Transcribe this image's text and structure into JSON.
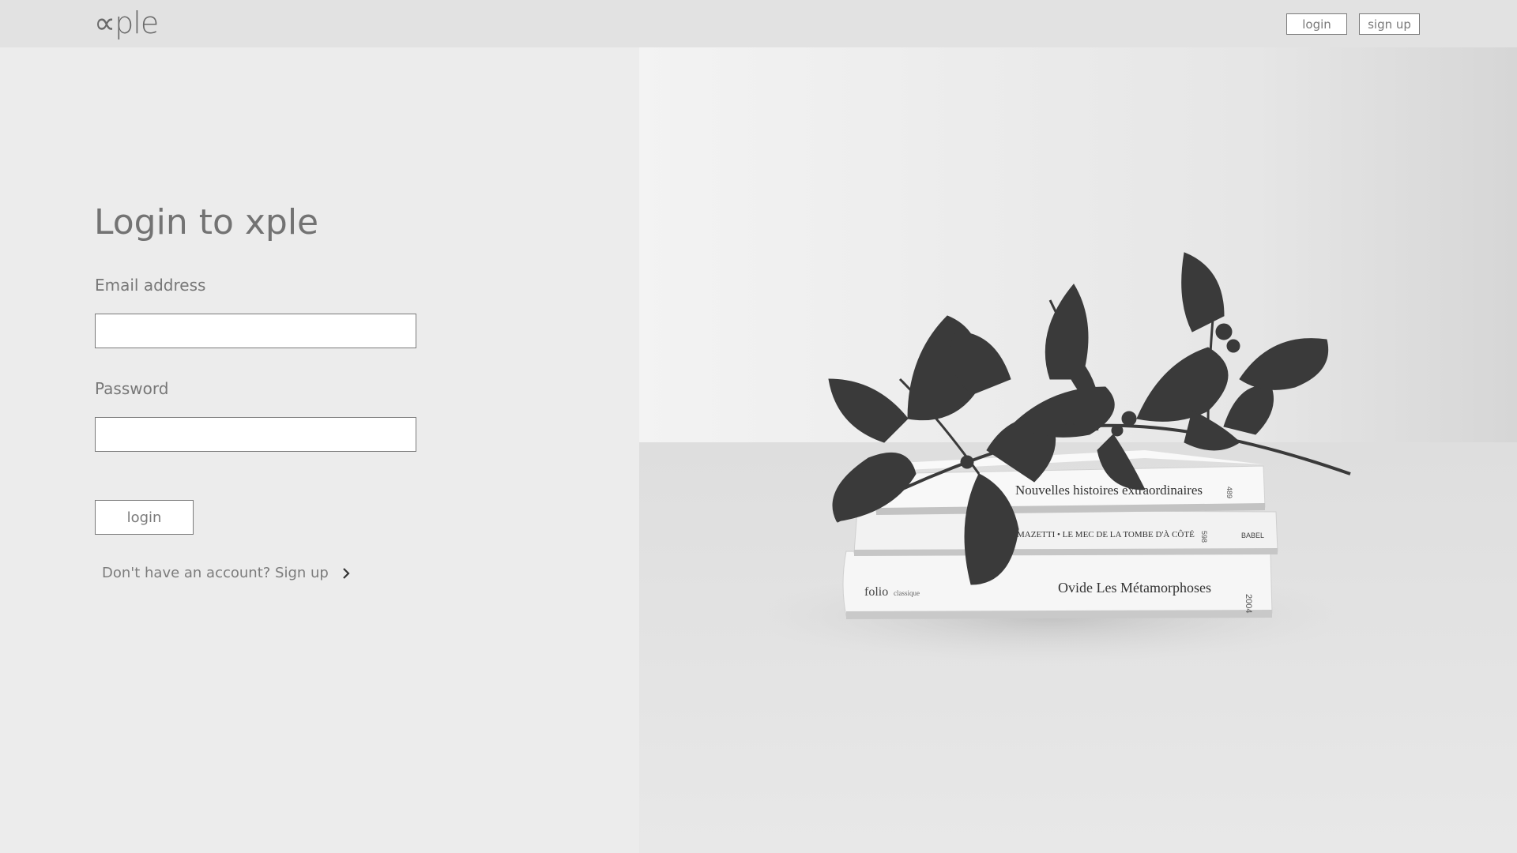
{
  "header": {
    "logo_text": "∝ple",
    "login_label": "login",
    "signup_label": "sign up"
  },
  "form": {
    "title": "Login to xple",
    "email_label": "Email address",
    "email_value": "",
    "password_label": "Password",
    "password_value": "",
    "submit_label": "login",
    "signup_prompt": "Don't have an account? Sign up"
  },
  "hero": {
    "book_titles": [
      "Nouvelles histoires extraordinaires",
      "MAZETTI • LE MEC DE LA TOMBE D'À CÔTÉ",
      "Ovide  Les Métamorphoses"
    ],
    "publisher_top": "BABEL",
    "publisher_bottom": "folio",
    "publisher_bottom_sub": "classique",
    "spine_number_top": "489",
    "spine_number_mid": "598",
    "spine_number_bottom": "2004"
  },
  "colors": {
    "header_bg": "#e2e2e2",
    "left_panel_bg": "#ececec",
    "text": "#707070",
    "border": "#7a7a7a"
  }
}
